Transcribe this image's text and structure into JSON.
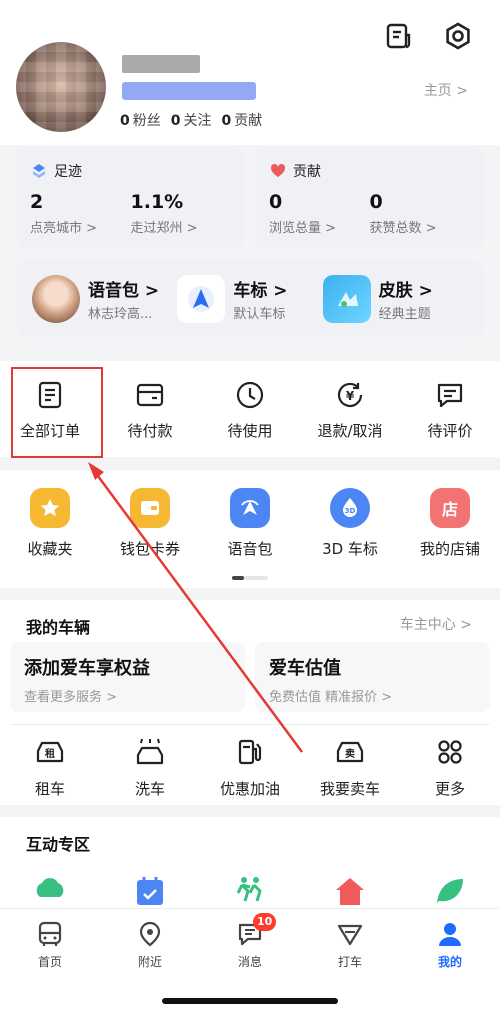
{
  "header": {
    "homepage_label": "主页 >",
    "stats": {
      "fans": "0",
      "fans_label": "粉丝",
      "follows": "0",
      "follows_label": "关注",
      "contrib": "0",
      "contrib_label": "贡献"
    }
  },
  "footprint": {
    "title": "足迹",
    "items": [
      {
        "value": "2",
        "label": "点亮城市 >"
      },
      {
        "value": "1.1%",
        "label": "走过郑州 >"
      }
    ]
  },
  "contribution": {
    "title": "贡献",
    "items": [
      {
        "value": "0",
        "label": "浏览总量 >"
      },
      {
        "value": "0",
        "label": "获赞总数 >"
      }
    ]
  },
  "features": [
    {
      "title": "语音包 >",
      "sub": "林志玲高..."
    },
    {
      "title": "车标 >",
      "sub": "默认车标"
    },
    {
      "title": "皮肤 >",
      "sub": "经典主题"
    }
  ],
  "orders": [
    "全部订单",
    "待付款",
    "待使用",
    "退款/取消",
    "待评价"
  ],
  "tools": [
    {
      "label": "收藏夹",
      "color": "#f6b733"
    },
    {
      "label": "钱包卡券",
      "color": "#f6b733"
    },
    {
      "label": "语音包",
      "color": "#4c86f5"
    },
    {
      "label": "3D 车标",
      "color": "#4c86f5"
    },
    {
      "label": "我的店铺",
      "color": "#f27372",
      "glyph": "店"
    }
  ],
  "vehicles": {
    "title": "我的车辆",
    "link": "车主中心 >",
    "cards": [
      {
        "title": "添加爱车享权益",
        "sub": "查看更多服务 >"
      },
      {
        "title": "爱车估值",
        "sub": "免费估值 精准报价 >"
      }
    ],
    "services": [
      "租车",
      "洗车",
      "优惠加油",
      "我要卖车",
      "更多"
    ],
    "rent_glyph": "租",
    "sell_glyph": "卖"
  },
  "interact": {
    "title": "互动专区"
  },
  "tabbar": {
    "tabs": [
      "首页",
      "附近",
      "消息",
      "打车",
      "我的"
    ],
    "message_badge": "10"
  }
}
